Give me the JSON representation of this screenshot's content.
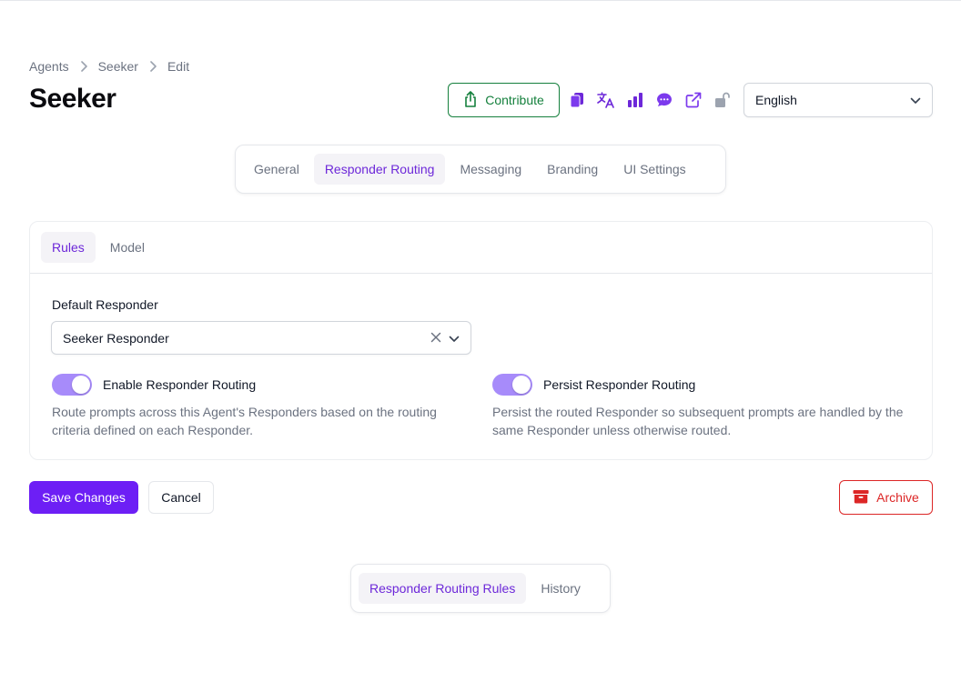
{
  "breadcrumb": {
    "items": [
      "Agents",
      "Seeker",
      "Edit"
    ]
  },
  "page": {
    "title": "Seeker"
  },
  "header": {
    "contribute_label": "Contribute",
    "icons": [
      "documents-icon",
      "translate-icon",
      "bar-chart-icon",
      "chat-bubble-icon",
      "external-link-icon",
      "unlock-icon"
    ],
    "language": {
      "selected": "English"
    }
  },
  "main_tabs": {
    "items": [
      "General",
      "Responder Routing",
      "Messaging",
      "Branding",
      "UI Settings"
    ],
    "active": "Responder Routing"
  },
  "routing_card": {
    "sub_tabs": {
      "items": [
        "Rules",
        "Model"
      ],
      "active": "Rules"
    },
    "default_responder": {
      "label": "Default Responder",
      "value": "Seeker Responder"
    },
    "enable_routing": {
      "title": "Enable Responder Routing",
      "enabled": true,
      "description": "Route prompts across this Agent's Responders based on the routing criteria defined on each Responder."
    },
    "persist_routing": {
      "title": "Persist Responder Routing",
      "enabled": true,
      "description": "Persist the routed Responder so subsequent prompts are handled by the same Responder unless otherwise routed."
    }
  },
  "actions": {
    "save_label": "Save Changes",
    "cancel_label": "Cancel",
    "archive_label": "Archive"
  },
  "bottom_tabs": {
    "items": [
      "Responder Routing Rules",
      "History"
    ],
    "active": "Responder Routing Rules"
  },
  "colors": {
    "accent": "#6d1ff5",
    "accent_text": "#6d28d9",
    "toggle_on": "#a78bfa",
    "success": "#15803d",
    "danger": "#dc2626"
  }
}
